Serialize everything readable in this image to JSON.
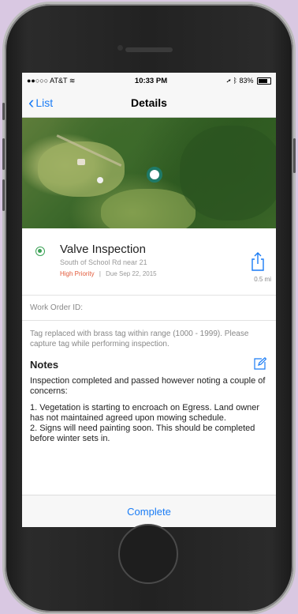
{
  "status_bar": {
    "carrier": "●●○○○ AT&T",
    "time": "10:33 PM",
    "battery_text": "83%"
  },
  "nav": {
    "back_label": "List",
    "title": "Details"
  },
  "work_order": {
    "title": "Valve Inspection",
    "location": "South of School Rd near 21",
    "priority": "High Priority",
    "separator": "|",
    "due": "Due Sep 22, 2015",
    "distance": "0.5 mi",
    "id_label": "Work Order ID:",
    "description": "Tag replaced with brass tag within range (1000 - 1999). Please capture tag while performing inspection."
  },
  "notes": {
    "heading": "Notes",
    "paragraphs": [
      "Inspection completed and passed however noting a couple of concerns:",
      "1. Vegetation is starting to encroach on Egress. Land owner has not maintained agreed upon mowing schedule.",
      "2. Signs will need painting soon. This should be completed before winter sets in."
    ]
  },
  "actions": {
    "complete_label": "Complete"
  },
  "colors": {
    "accent": "#1a7cf5",
    "priority": "#e25a3a",
    "status_green": "#3aa155",
    "pin": "#1f7a68"
  },
  "icons": [
    "wifi-icon",
    "location-arrow-icon",
    "bluetooth-icon",
    "battery-icon",
    "chevron-left-icon",
    "status-radio-icon",
    "share-icon",
    "edit-icon",
    "map-pin-icon"
  ]
}
